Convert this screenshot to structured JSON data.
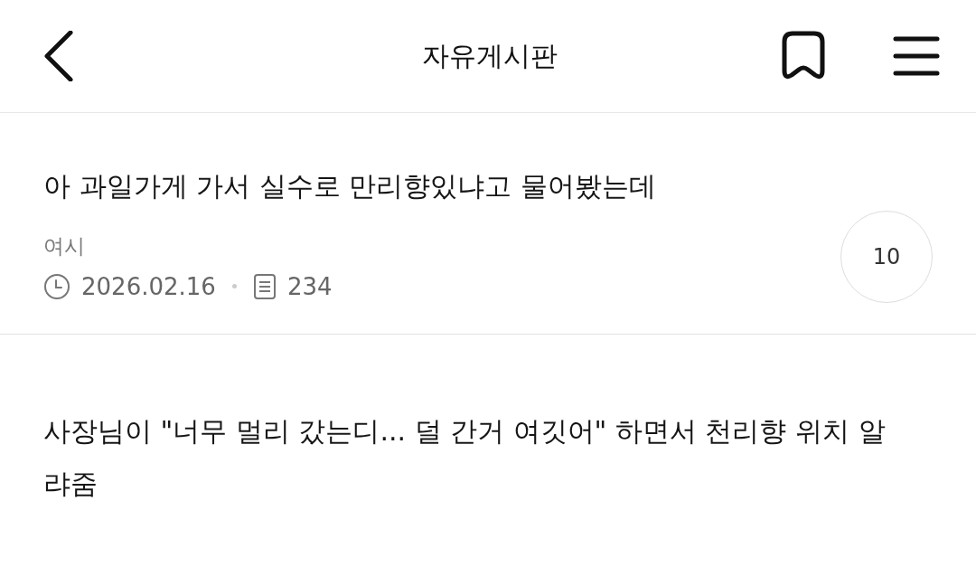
{
  "header": {
    "title": "자유게시판"
  },
  "posts": [
    {
      "title": "아 과일가게 가서 실수로 만리향있냐고 물어봤는데",
      "author": "여시",
      "date": "2026.02.16",
      "views": "234",
      "comments": "10"
    },
    {
      "title": "사장님이 \"너무 멀리 갔는디... 덜 간거 여깃어\" 하면서 천리향 위치 알랴줌"
    }
  ]
}
